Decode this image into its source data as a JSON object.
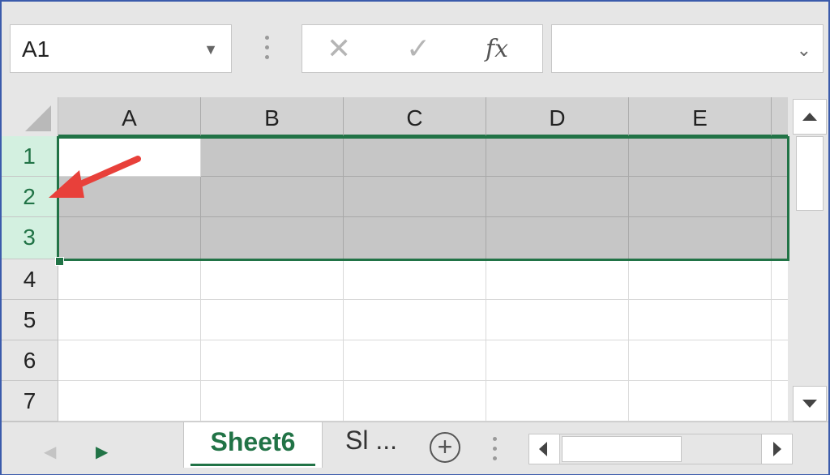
{
  "formula_bar": {
    "name_box": "A1",
    "cancel_icon": "x-icon",
    "enter_icon": "check-icon",
    "function_label": "fx",
    "formula_value": ""
  },
  "columns": [
    "A",
    "B",
    "C",
    "D",
    "E"
  ],
  "rows": [
    "1",
    "2",
    "3",
    "4",
    "5",
    "6",
    "7"
  ],
  "selection": {
    "rows_selected": [
      "1",
      "2",
      "3"
    ],
    "active_cell": "A1"
  },
  "sheet_tabs": {
    "active": "Sheet6",
    "other": "Sl ...",
    "add_icon": "plus-circle-icon"
  },
  "colors": {
    "accent": "#217346",
    "selection_fill": "#c6c6c6",
    "annotation_arrow": "#e8403a"
  }
}
